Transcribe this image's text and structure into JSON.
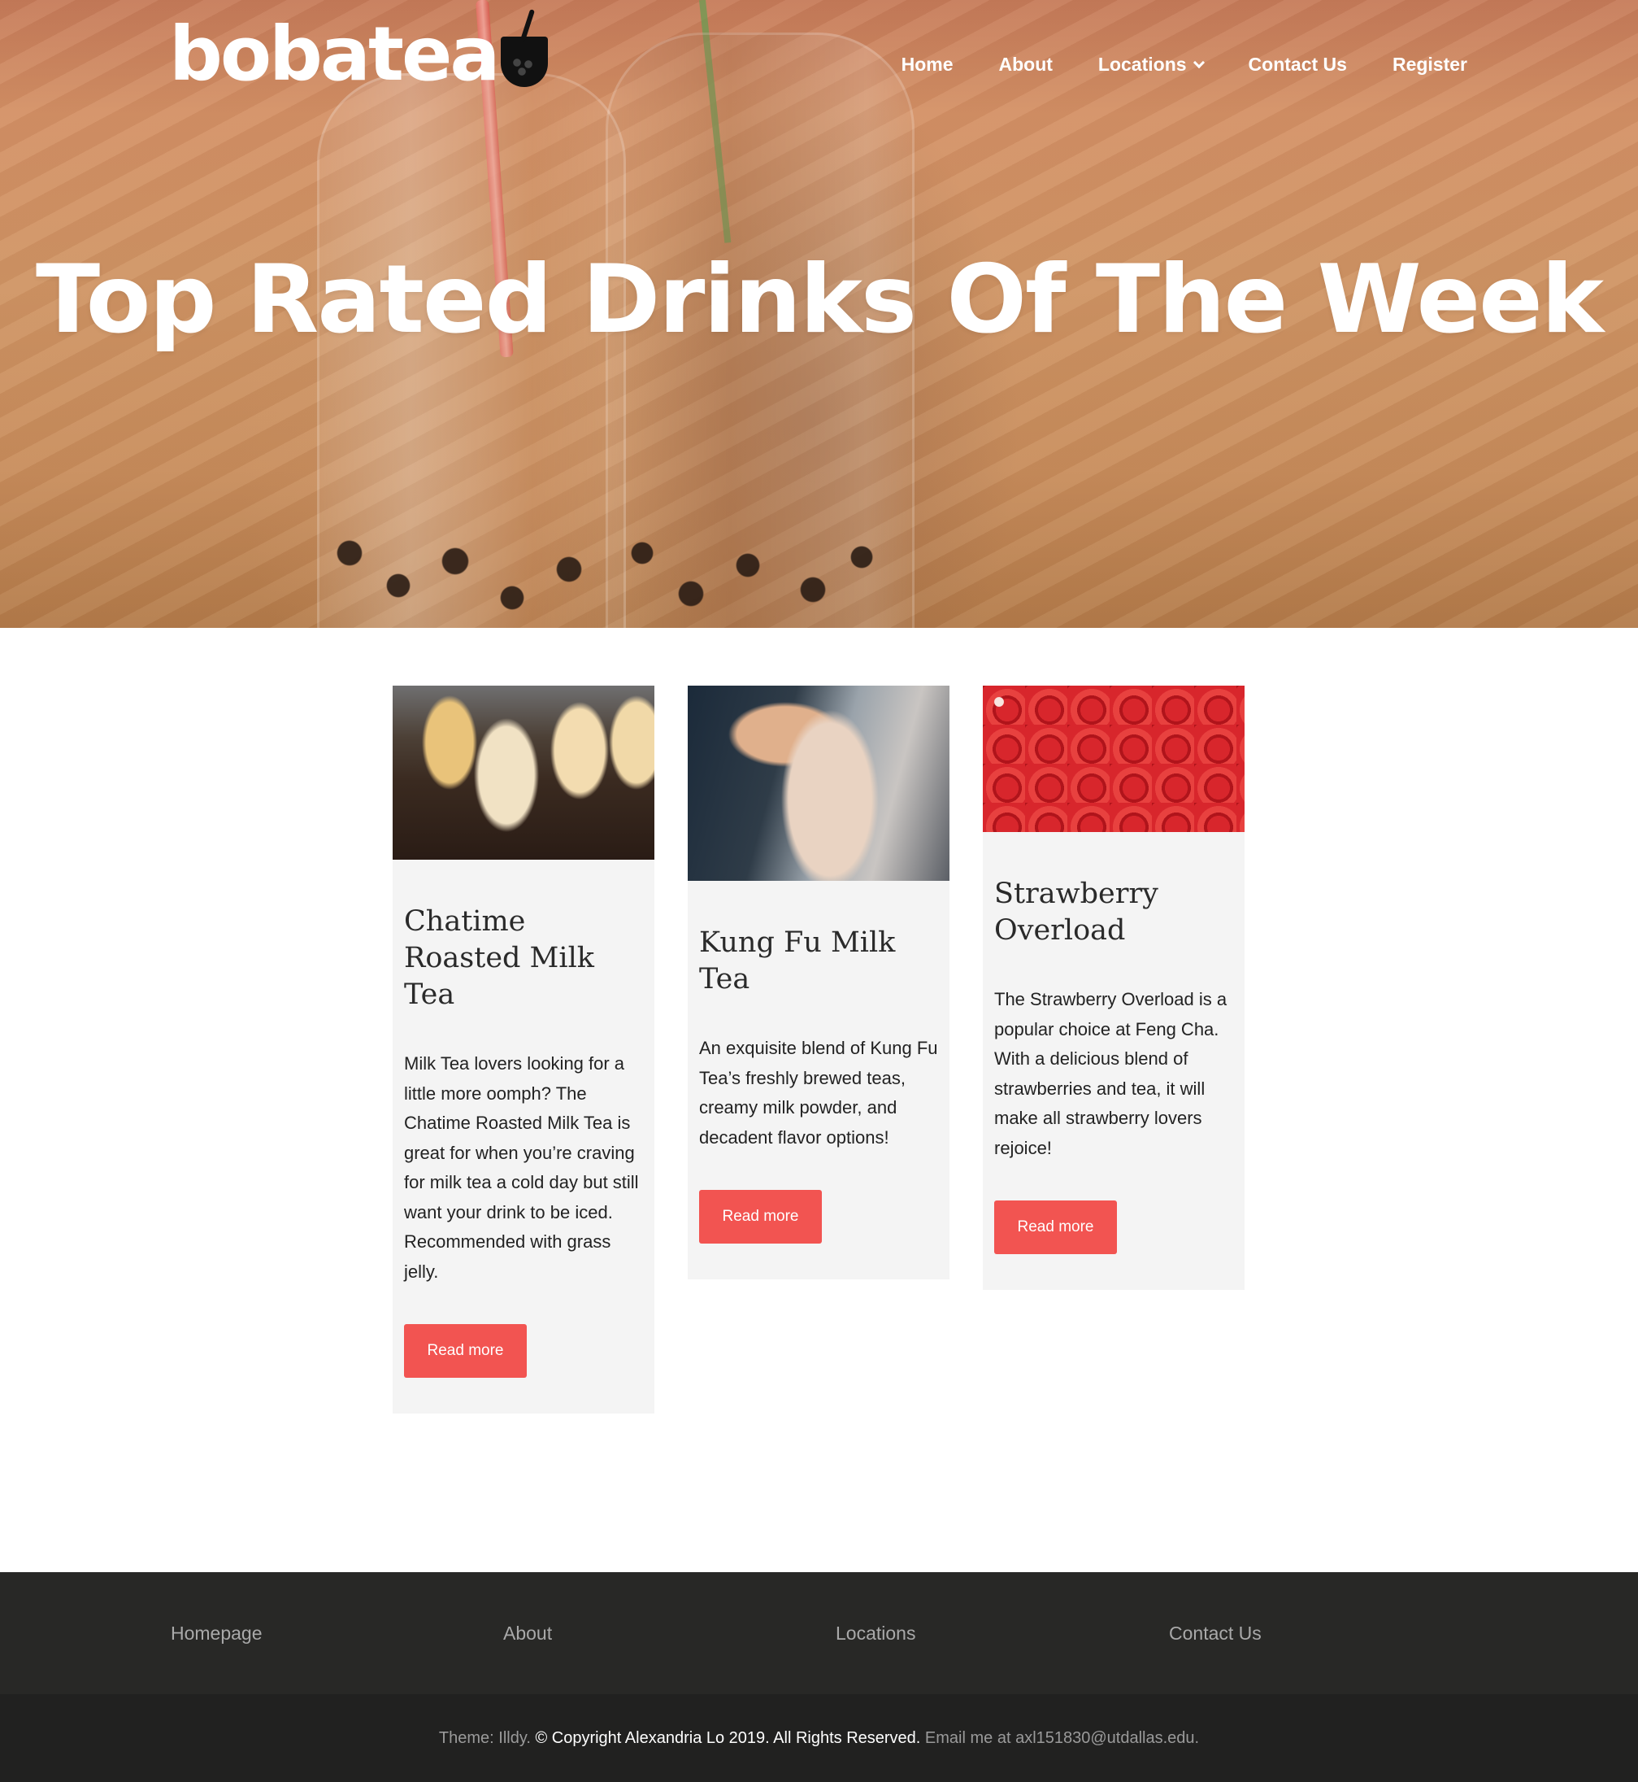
{
  "header": {
    "logo_text": "bobatea",
    "nav": [
      {
        "label": "Home"
      },
      {
        "label": "About"
      },
      {
        "label": "Locations"
      },
      {
        "label": "Contact Us"
      },
      {
        "label": "Register"
      }
    ]
  },
  "hero": {
    "title": "Top Rated Drinks Of The Week"
  },
  "cards": [
    {
      "title": "Chatime Roasted Milk Tea",
      "text": "Milk Tea lovers looking for a little more oomph? The Chatime Roasted Milk Tea is great for when you’re craving for milk tea a cold day but still want your drink to be iced. Recommended with grass jelly.",
      "button": "Read more"
    },
    {
      "title": "Kung Fu Milk Tea",
      "text": "An exquisite blend of Kung Fu Tea’s freshly brewed teas, creamy milk powder, and decadent flavor options!",
      "button": "Read more"
    },
    {
      "title": "Strawberry Overload",
      "text": "The Strawberry Overload is a popular choice at Feng Cha. With a delicious blend of strawberries and tea, it will make all strawberry lovers rejoice!",
      "button": "Read more"
    }
  ],
  "footer": {
    "links": [
      {
        "label": "Homepage"
      },
      {
        "label": "About"
      },
      {
        "label": "Locations"
      },
      {
        "label": "Contact Us"
      }
    ],
    "theme_text": "Theme: Illdy.",
    "copyright": "© Copyright Alexandria Lo 2019. All Rights Reserved.",
    "email_text": "Email me at axl151830@utdallas.edu."
  },
  "colors": {
    "accent": "#f25451",
    "footer_top": "#282826",
    "footer_bottom": "#212120",
    "card_bg": "#f4f4f4"
  }
}
